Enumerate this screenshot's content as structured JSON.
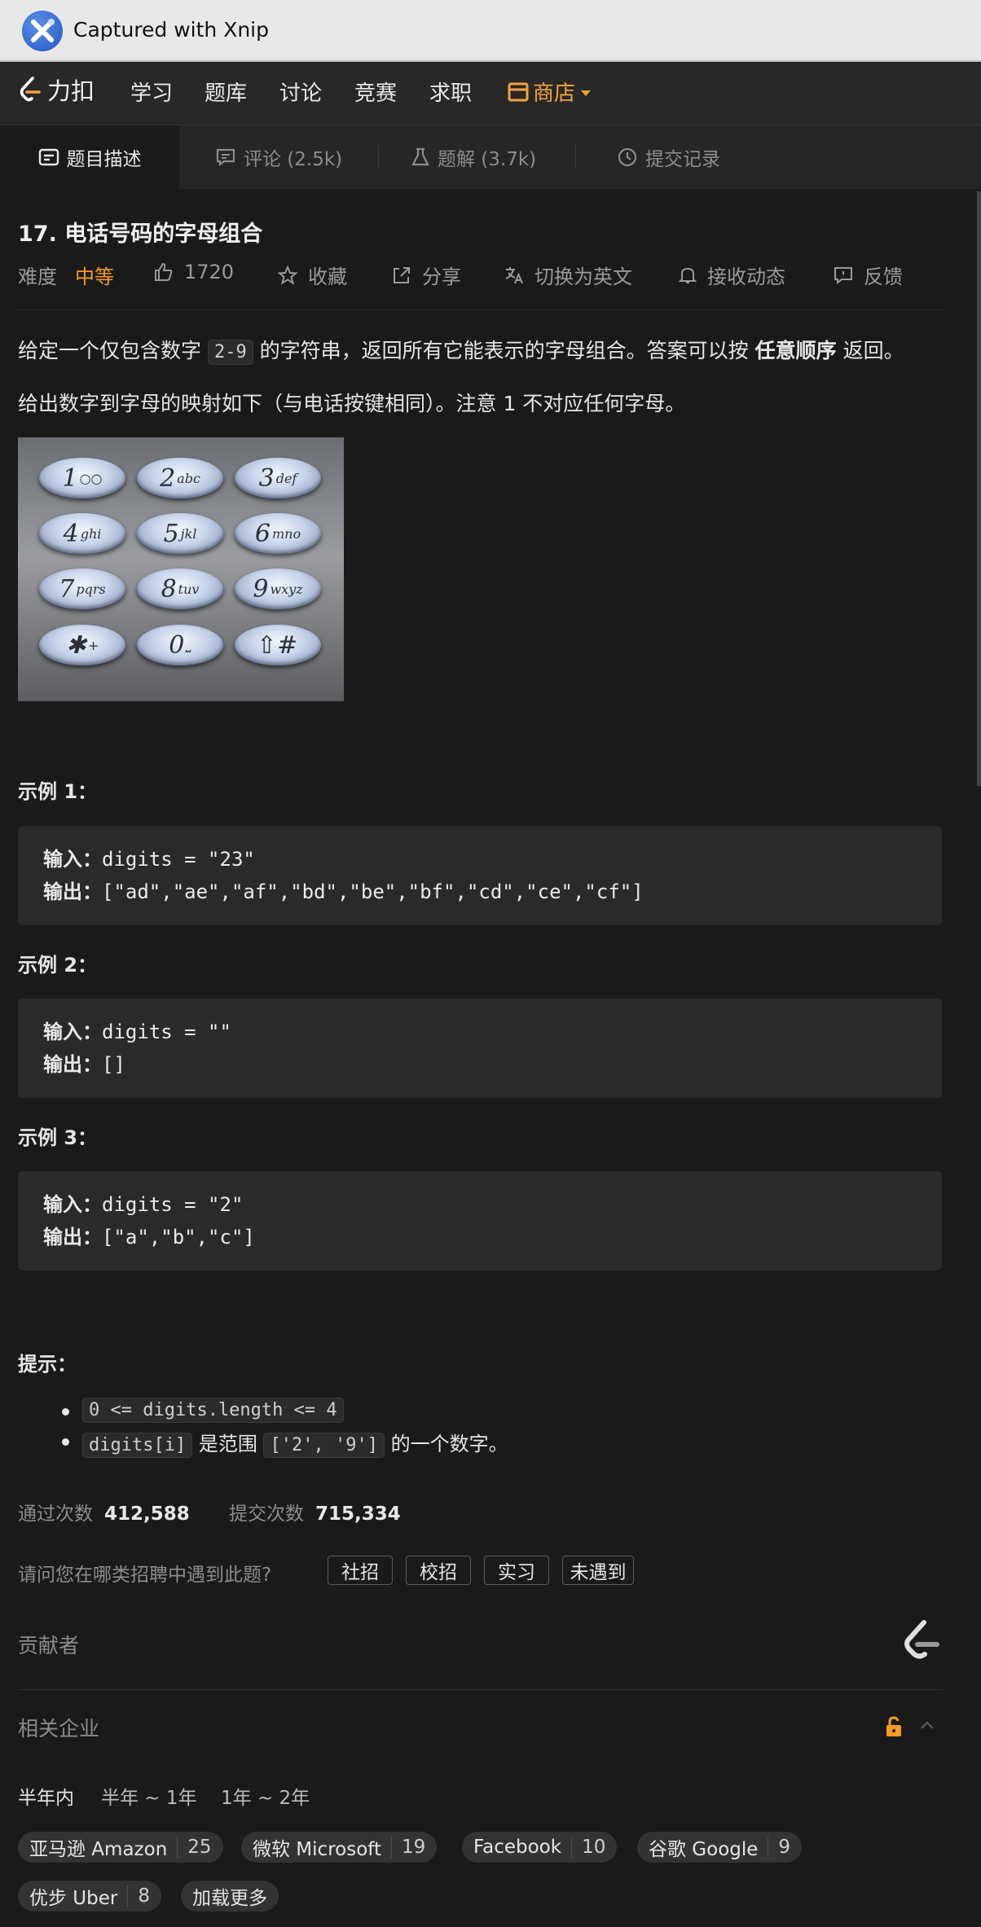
{
  "xnip": {
    "title": "Captured with Xnip"
  },
  "nav": {
    "brand": "力扣",
    "items": [
      "学习",
      "题库",
      "讨论",
      "竞赛",
      "求职"
    ],
    "shop": "商店"
  },
  "tabs": [
    "题目描述",
    "评论 (2.5k)",
    "题解 (3.7k)",
    "提交记录"
  ],
  "problem": {
    "title": "17. 电话号码的字母组合",
    "difficulty_label": "难度",
    "difficulty": "中等",
    "likes": "1720",
    "favorite": "收藏",
    "share": "分享",
    "switch_lang": "切换为英文",
    "subscribe": "接收动态",
    "feedback": "反馈",
    "desc1": {
      "pre": "给定一个仅包含数字 ",
      "code": "2-9",
      "mid": " 的字符串，返回所有它能表示的字母组合。答案可以按 ",
      "bold": "任意顺序",
      "post": " 返回。"
    },
    "desc2": "给出数字到字母的映射如下（与电话按键相同）。注意 1 不对应任何字母。",
    "keypad": [
      {
        "d": "1",
        "s": "○○"
      },
      {
        "d": "2",
        "s": "abc"
      },
      {
        "d": "3",
        "s": "def"
      },
      {
        "d": "4",
        "s": "ghi"
      },
      {
        "d": "5",
        "s": "jkl"
      },
      {
        "d": "6",
        "s": "mno"
      },
      {
        "d": "7",
        "s": "pqrs"
      },
      {
        "d": "8",
        "s": "tuv"
      },
      {
        "d": "9",
        "s": "wxyz"
      },
      {
        "d": "✱",
        "s": "+"
      },
      {
        "d": "0",
        "s": "⎵"
      },
      {
        "d": "⇧#",
        "s": ""
      }
    ]
  },
  "examples": [
    {
      "head": "示例 1：",
      "in_label": "输入：",
      "in": "digits = \"23\"",
      "out_label": "输出：",
      "out": "[\"ad\",\"ae\",\"af\",\"bd\",\"be\",\"bf\",\"cd\",\"ce\",\"cf\"]"
    },
    {
      "head": "示例 2：",
      "in_label": "输入：",
      "in": "digits = \"\"",
      "out_label": "输出：",
      "out": "[]"
    },
    {
      "head": "示例 3：",
      "in_label": "输入：",
      "in": "digits = \"2\"",
      "out_label": "输出：",
      "out": "[\"a\",\"b\",\"c\"]"
    }
  ],
  "hints": {
    "head": "提示：",
    "c1": "0 <= digits.length <= 4",
    "c2_code": "digits[i]",
    "c2_mid": " 是范围 ",
    "c2_code2": "['2', '9']",
    "c2_post": " 的一个数字。"
  },
  "stats": {
    "accepted_label": "通过次数",
    "accepted": "412,588",
    "submitted_label": "提交次数",
    "submitted": "715,334"
  },
  "survey": {
    "question": "请问您在哪类招聘中遇到此题?",
    "options": [
      "社招",
      "校招",
      "实习",
      "未遇到"
    ]
  },
  "contributors": "贡献者",
  "companies": {
    "label": "相关企业",
    "periods": [
      "半年内",
      "半年 ~ 1年",
      "1年 ~ 2年"
    ],
    "tags": [
      {
        "name": "亚马逊 Amazon",
        "count": "25"
      },
      {
        "name": "微软 Microsoft",
        "count": "19"
      },
      {
        "name": "Facebook",
        "count": "10"
      },
      {
        "name": "谷歌 Google",
        "count": "9"
      },
      {
        "name": "优步 Uber",
        "count": "8"
      }
    ],
    "more": "加载更多"
  },
  "colors": {
    "accent": "#f59a23",
    "background": "#1a1a1a",
    "code_bg": "#2a2a2a"
  }
}
